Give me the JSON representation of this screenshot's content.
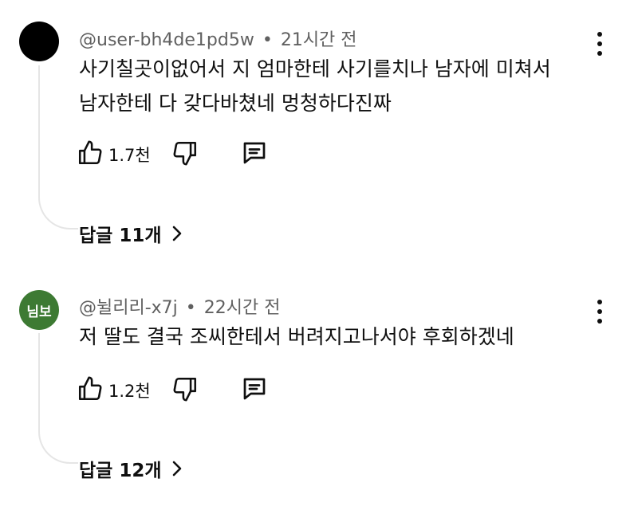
{
  "comments": [
    {
      "avatar_text": "",
      "avatar_color": "#000000",
      "author": "@user-bh4de1pd5w",
      "time": "21시간 전",
      "text_line1": "사기칠곳이없어서 지 엄마한테 사기를치나 남자에 미쳐서",
      "text_line2": "남자한테 다 갖다바쳤네 멍청하다진짜",
      "likes": "1.7천",
      "replies_label": "답글 11개"
    },
    {
      "avatar_text": "님보",
      "avatar_color": "#3d7a33",
      "author": "@뉠리리-x7j",
      "time": "22시간 전",
      "text_line1": "저 딸도 결국 조씨한테서 버려지고나서야 후회하겠네",
      "likes": "1.2천",
      "replies_label": "답글 12개"
    }
  ],
  "meta": {
    "separator": "•"
  },
  "icons": [
    "like-icon",
    "dislike-icon",
    "reply-icon",
    "more-options-icon",
    "chevron-right-icon"
  ]
}
